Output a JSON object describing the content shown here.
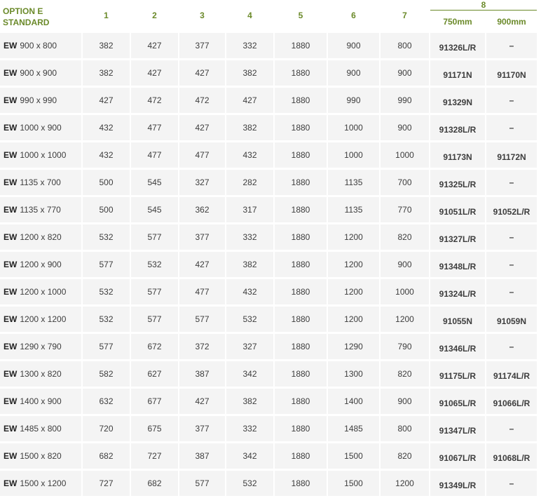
{
  "header": {
    "option_line1": "OPTION E",
    "option_line2": "STANDARD",
    "columns": [
      "1",
      "2",
      "3",
      "4",
      "5",
      "6",
      "7"
    ],
    "col8_label": "8",
    "col8_sub": [
      "750mm",
      "900mm"
    ]
  },
  "rows": [
    {
      "prefix": "EW",
      "size": "900 x 800",
      "vals": [
        "382",
        "427",
        "377",
        "332",
        "1880",
        "900",
        "800"
      ],
      "code750": "91326L/R",
      "code900": "–"
    },
    {
      "prefix": "EW",
      "size": "900 x 900",
      "vals": [
        "382",
        "427",
        "427",
        "382",
        "1880",
        "900",
        "900"
      ],
      "code750": "91171N",
      "code900": "91170N"
    },
    {
      "prefix": "EW",
      "size": "990 x 990",
      "vals": [
        "427",
        "472",
        "472",
        "427",
        "1880",
        "990",
        "990"
      ],
      "code750": "91329N",
      "code900": "–"
    },
    {
      "prefix": "EW",
      "size": "1000 x 900",
      "vals": [
        "432",
        "477",
        "427",
        "382",
        "1880",
        "1000",
        "900"
      ],
      "code750": "91328L/R",
      "code900": "–"
    },
    {
      "prefix": "EW",
      "size": "1000 x 1000",
      "vals": [
        "432",
        "477",
        "477",
        "432",
        "1880",
        "1000",
        "1000"
      ],
      "code750": "91173N",
      "code900": "91172N"
    },
    {
      "prefix": "EW",
      "size": "1135 x 700",
      "vals": [
        "500",
        "545",
        "327",
        "282",
        "1880",
        "1135",
        "700"
      ],
      "code750": "91325L/R",
      "code900": "–"
    },
    {
      "prefix": "EW",
      "size": "1135 x 770",
      "vals": [
        "500",
        "545",
        "362",
        "317",
        "1880",
        "1135",
        "770"
      ],
      "code750": "91051L/R",
      "code900": "91052L/R"
    },
    {
      "prefix": "EW",
      "size": "1200 x 820",
      "vals": [
        "532",
        "577",
        "377",
        "332",
        "1880",
        "1200",
        "820"
      ],
      "code750": "91327L/R",
      "code900": "–"
    },
    {
      "prefix": "EW",
      "size": "1200 x 900",
      "vals": [
        "577",
        "532",
        "427",
        "382",
        "1880",
        "1200",
        "900"
      ],
      "code750": "91348L/R",
      "code900": "–"
    },
    {
      "prefix": "EW",
      "size": "1200 x 1000",
      "vals": [
        "532",
        "577",
        "477",
        "432",
        "1880",
        "1200",
        "1000"
      ],
      "code750": "91324L/R",
      "code900": "–"
    },
    {
      "prefix": "EW",
      "size": "1200 x 1200",
      "vals": [
        "532",
        "577",
        "577",
        "532",
        "1880",
        "1200",
        "1200"
      ],
      "code750": "91055N",
      "code900": "91059N"
    },
    {
      "prefix": "EW",
      "size": "1290 x 790",
      "vals": [
        "577",
        "672",
        "372",
        "327",
        "1880",
        "1290",
        "790"
      ],
      "code750": "91346L/R",
      "code900": "–"
    },
    {
      "prefix": "EW",
      "size": "1300 x 820",
      "vals": [
        "582",
        "627",
        "387",
        "342",
        "1880",
        "1300",
        "820"
      ],
      "code750": "91175L/R",
      "code900": "91174L/R"
    },
    {
      "prefix": "EW",
      "size": "1400 x 900",
      "vals": [
        "632",
        "677",
        "427",
        "382",
        "1880",
        "1400",
        "900"
      ],
      "code750": "91065L/R",
      "code900": "91066L/R"
    },
    {
      "prefix": "EW",
      "size": "1485 x 800",
      "vals": [
        "720",
        "675",
        "377",
        "332",
        "1880",
        "1485",
        "800"
      ],
      "code750": "91347L/R",
      "code900": "–"
    },
    {
      "prefix": "EW",
      "size": "1500 x 820",
      "vals": [
        "682",
        "727",
        "387",
        "342",
        "1880",
        "1500",
        "820"
      ],
      "code750": "91067L/R",
      "code900": "91068L/R"
    },
    {
      "prefix": "EW",
      "size": "1500 x 1200",
      "vals": [
        "727",
        "682",
        "577",
        "532",
        "1880",
        "1500",
        "1200"
      ],
      "code750": "91349L/R",
      "code900": "–"
    }
  ],
  "colors": {
    "header_green": "#6b8a2a",
    "cell_bg": "#f4f4f4"
  }
}
